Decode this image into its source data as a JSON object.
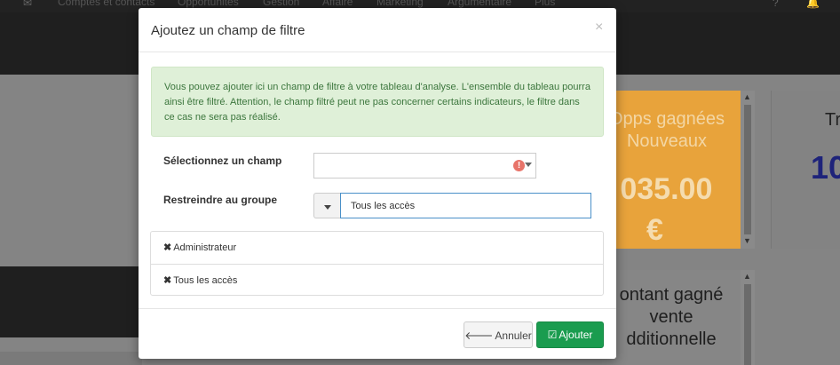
{
  "topnav": {
    "items": [
      "Comptes et contacts",
      "Opportunités",
      "Gestion",
      "Affaire",
      "Marketing",
      "Argumentaire",
      "Plus"
    ]
  },
  "background": {
    "tile_orange": {
      "line1": "Opps gagnées",
      "line2": "Nouveaux",
      "value": "0 035.00",
      "currency": "€"
    },
    "tile_right": {
      "line1": "Tr",
      "value": "10"
    },
    "tile_grey": {
      "line1": "ontant gagné",
      "line2": "vente",
      "line3": "dditionnelle"
    }
  },
  "modal": {
    "title": "Ajoutez un champ de filtre",
    "close": "×",
    "info": "Vous pouvez ajouter ici un champ de filtre à votre tableau d'analyse. L'ensemble du tableau pourra ainsi être filtré. Attention, le champ filtré peut ne pas concerner certains indicateurs, le filtre dans ce cas ne sera pas réalisé.",
    "field_label": "Sélectionnez un champ",
    "group_label": "Restreindre au groupe",
    "group_value": "Tous les accès",
    "groups": [
      "Administrateur",
      "Tous les accès"
    ],
    "cancel_label": "Annuler",
    "add_label": "Ajouter"
  },
  "colors": {
    "orange_tile": "#e8a33b",
    "success_alert": "#dff0d8",
    "add_button": "#1a9c4f"
  }
}
